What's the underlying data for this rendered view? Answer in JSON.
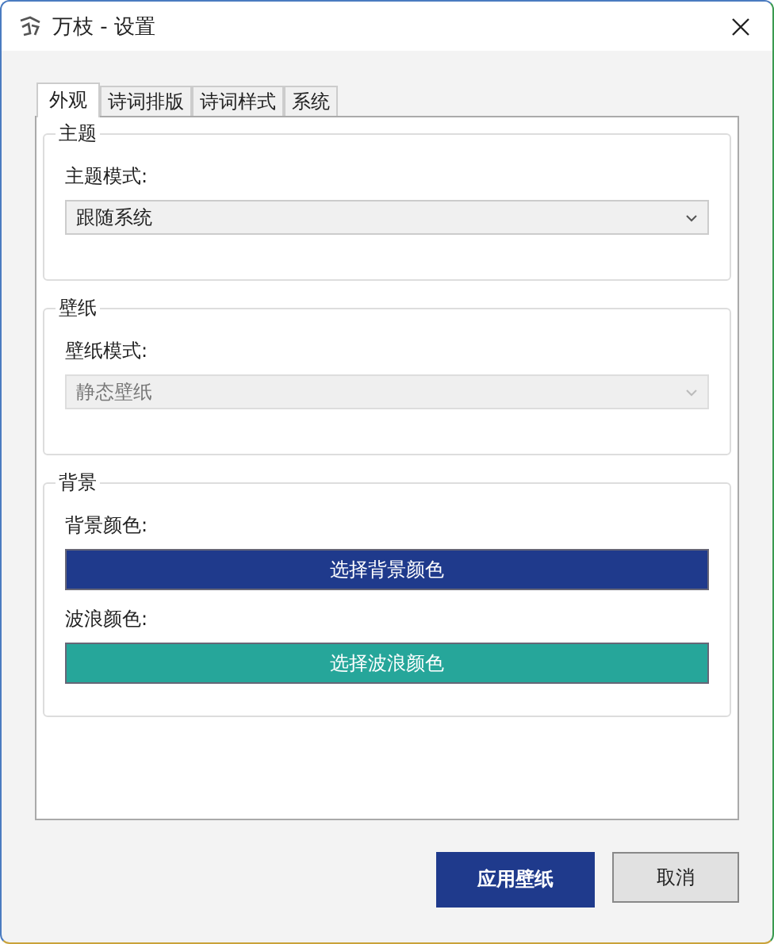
{
  "window": {
    "title": "万枝 - 设置"
  },
  "tabs": [
    {
      "label": "外观",
      "selected": true
    },
    {
      "label": "诗词排版",
      "selected": false
    },
    {
      "label": "诗词样式",
      "selected": false
    },
    {
      "label": "系统",
      "selected": false
    }
  ],
  "groups": [
    {
      "title": "主题",
      "fields": [
        {
          "kind": "dropdown",
          "label": "主题模式:",
          "value": "跟随系统",
          "disabled": false
        }
      ]
    },
    {
      "title": "壁纸",
      "fields": [
        {
          "kind": "dropdown",
          "label": "壁纸模式:",
          "value": "静态壁纸",
          "disabled": true
        }
      ]
    },
    {
      "title": "背景",
      "fields": [
        {
          "kind": "color",
          "label": "背景颜色:",
          "button": "选择背景颜色",
          "color": "#1f3a8c"
        },
        {
          "kind": "color",
          "label": "波浪颜色:",
          "button": "选择波浪颜色",
          "color": "#26a69a"
        }
      ]
    }
  ],
  "buttons": [
    {
      "label": "应用壁纸",
      "kind": "primary"
    },
    {
      "label": "取消",
      "kind": "secondary"
    }
  ]
}
